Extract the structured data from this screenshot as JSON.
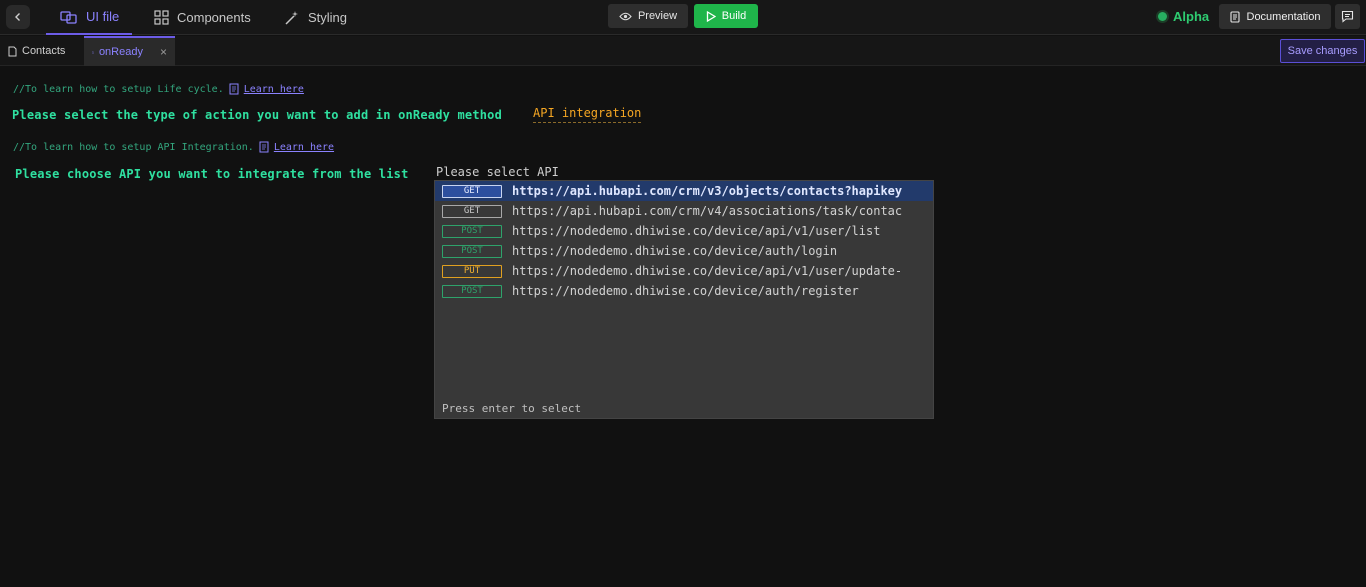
{
  "topbar": {
    "nav": [
      {
        "label": "UI file",
        "icon": "ui-file-icon",
        "active": true
      },
      {
        "label": "Components",
        "icon": "components-grid-icon",
        "active": false
      },
      {
        "label": "Styling",
        "icon": "magic-wand-icon",
        "active": false
      }
    ],
    "preview_label": "Preview",
    "build_label": "Build",
    "env_label": "Alpha",
    "docs_label": "Documentation"
  },
  "tabs": [
    {
      "label": "Contacts",
      "active": false
    },
    {
      "label": "onReady",
      "active": true,
      "close": "×"
    }
  ],
  "save_label": "Save changes",
  "editor": {
    "lifecycle_comment": "//To learn how to setup Life cycle.",
    "lifecycle_link": "Learn here",
    "action_prompt": "Please select the type of action you want to add in onReady method",
    "action_value": "API integration",
    "api_comment": "//To learn how to setup API Integration.",
    "api_link": "Learn here",
    "api_prompt": "Please choose API you want to integrate from the list",
    "api_placeholder": "Please select API"
  },
  "dropdown": {
    "options": [
      {
        "method": "GET",
        "url": "https://api.hubapi.com/crm/v3/objects/contacts?hapikey",
        "selected": true
      },
      {
        "method": "GET",
        "url": "https://api.hubapi.com/crm/v4/associations/task/contac",
        "selected": false
      },
      {
        "method": "POST",
        "url": "https://nodedemo.dhiwise.co/device/api/v1/user/list",
        "selected": false
      },
      {
        "method": "POST",
        "url": "https://nodedemo.dhiwise.co/device/auth/login",
        "selected": false
      },
      {
        "method": "PUT",
        "url": "https://nodedemo.dhiwise.co/device/api/v1/user/update-",
        "selected": false
      },
      {
        "method": "POST",
        "url": "https://nodedemo.dhiwise.co/device/auth/register",
        "selected": false
      }
    ],
    "footer": "Press enter to select"
  },
  "colors": {
    "accent": "#6c5ce7",
    "build_green": "#1fb54a",
    "prompt_green": "#2fe0a0",
    "action_orange": "#f5a623",
    "selected_row": "#223a6b"
  }
}
